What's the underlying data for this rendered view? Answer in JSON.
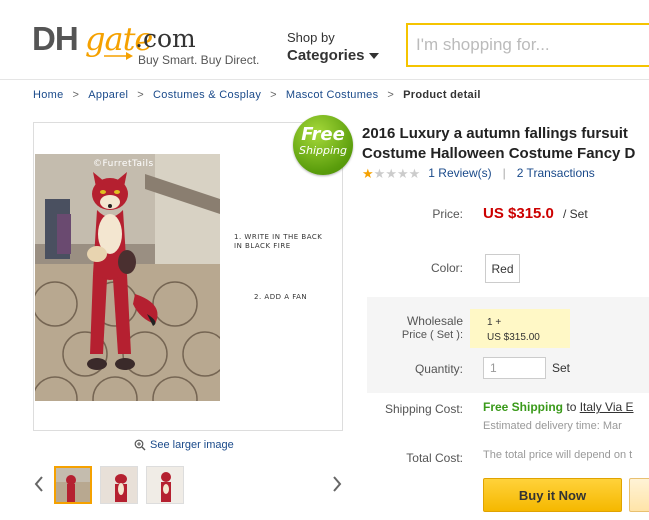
{
  "header": {
    "logo_dh": "DH",
    "logo_gate": "gate",
    "logo_com": ".com",
    "logo_tagline": "Buy Smart. Buy Direct.",
    "shop_by": "Shop by",
    "categories": "Categories",
    "search_placeholder": "I'm shopping for..."
  },
  "breadcrumb": {
    "items": [
      "Home",
      "Apparel",
      "Costumes & Cosplay",
      "Mascot Costumes"
    ],
    "separator": ">",
    "current": "Product detail"
  },
  "gallery": {
    "free_shipping_line1": "Free",
    "free_shipping_line2": "Shipping",
    "watermark": "©FurretTails",
    "annotation_1": "1. WRITE IN THE BACK IN BLACK FIRE",
    "annotation_2": "2. ADD A FAN",
    "see_larger": "See larger image",
    "thumbnail_count": 3
  },
  "product": {
    "title_line1": "2016 Luxury a autumn fallings fursuit",
    "title_line2": "Costume Halloween Costume Fancy D",
    "rating_stars": 1,
    "reviews": "1 Review(s)",
    "transactions": "2 Transactions",
    "price_label": "Price:",
    "price": "US $315.0",
    "price_unit": "/ Set",
    "color_label": "Color:",
    "color_value": "Red",
    "wholesale_label_line1": "Wholesale",
    "wholesale_label_line2": "Price ( Set ):",
    "wholesale_qty": "1 +",
    "wholesale_price": "US $315.00",
    "quantity_label": "Quantity:",
    "quantity_value": "1",
    "quantity_unit": "Set",
    "shipping_label": "Shipping Cost:",
    "shipping_free": "Free Shipping",
    "shipping_to": "to",
    "shipping_method": "Italy Via E",
    "shipping_estimate": "Estimated delivery time: Mar",
    "total_label": "Total Cost:",
    "total_note": "The total price will depend on t",
    "buy_now": "Buy it Now"
  },
  "colors": {
    "accent_yellow": "#f5b800",
    "price_red": "#cc0000",
    "link_blue": "#1a4a8a",
    "free_green": "#3a9a1a"
  }
}
